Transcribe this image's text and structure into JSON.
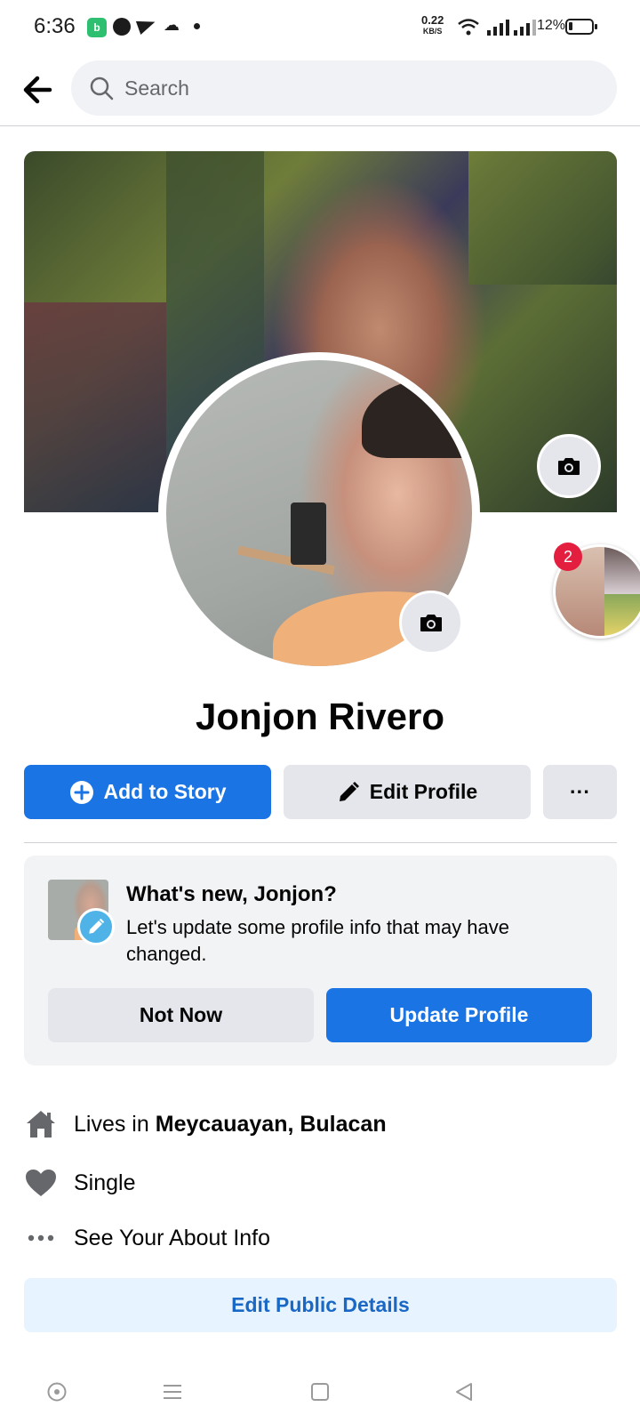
{
  "status_bar": {
    "time": "6:36",
    "net_speed_value": "0.22",
    "net_speed_unit": "KB/S",
    "battery_percent": "12%"
  },
  "search": {
    "placeholder": "Search"
  },
  "profile": {
    "name": "Jonjon Rivero",
    "story_badge_count": "2"
  },
  "actions": {
    "add_to_story": "Add to Story",
    "edit_profile": "Edit Profile",
    "more": "···"
  },
  "whats_new": {
    "title": "What's new, Jonjon?",
    "text": "Let's update some profile info that may have changed.",
    "not_now": "Not Now",
    "update_profile": "Update Profile"
  },
  "details": {
    "lives_in_prefix": "Lives in",
    "lives_in_place": "Meycauayan, Bulacan",
    "relationship": "Single",
    "see_about": "See Your About Info",
    "edit_public_details": "Edit Public Details"
  },
  "colors": {
    "brand_blue": "#1b74e4",
    "badge_red": "#e41e3f",
    "light_blue_bg": "#e7f3ff"
  },
  "icons": [
    "back-arrow-icon",
    "search-icon",
    "camera-icon",
    "plus-circle-icon",
    "pencil-icon",
    "home-icon",
    "heart-icon",
    "more-dots-icon"
  ]
}
